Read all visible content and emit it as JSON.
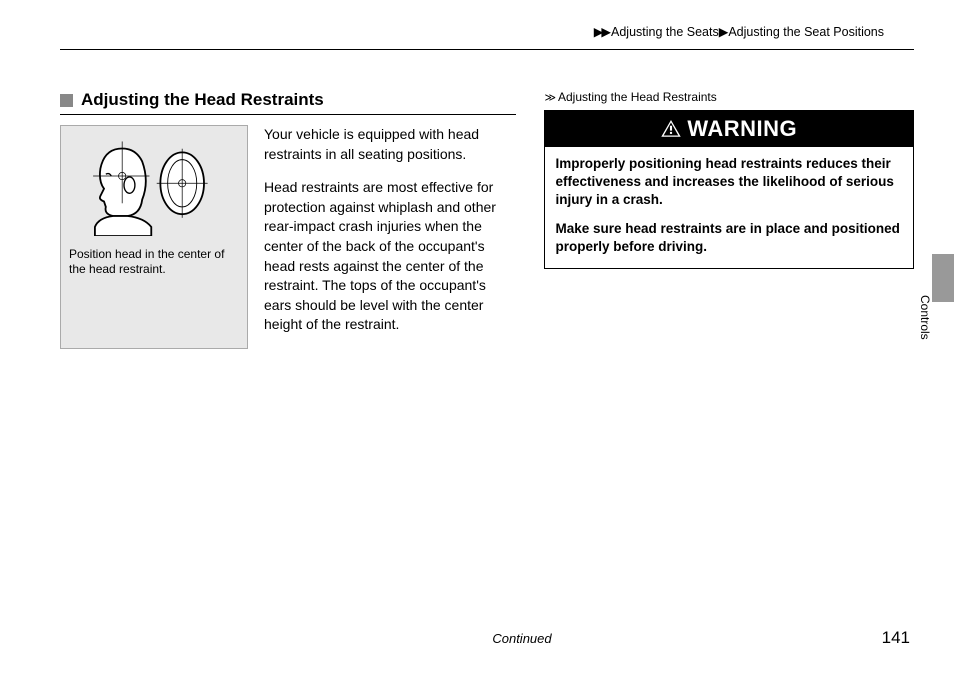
{
  "breadcrumb": {
    "arrows": "▶▶",
    "part1": "Adjusting the Seats",
    "sep": "▶",
    "part2": "Adjusting the Seat Positions"
  },
  "section": {
    "heading": "Adjusting the Head Restraints"
  },
  "illustration": {
    "caption": "Position head in the center of the head restraint."
  },
  "body": {
    "p1": "Your vehicle is equipped with head restraints in all seating positions.",
    "p2": "Head restraints are most effective for protection against whiplash and other rear-impact crash injuries when the center of the back of the occupant's head rests against the center of the restraint. The tops of the occupant's ears should be level with the center height of the restraint."
  },
  "rightSub": {
    "arrows": "≫",
    "text": "Adjusting the Head Restraints"
  },
  "warning": {
    "title": "WARNING",
    "p1": "Improperly positioning head restraints reduces their effectiveness and increases the likelihood of serious injury in a crash.",
    "p2": "Make sure head restraints are in place and positioned properly before driving."
  },
  "sideLabel": "Controls",
  "footer": {
    "continued": "Continued",
    "page": "141"
  }
}
